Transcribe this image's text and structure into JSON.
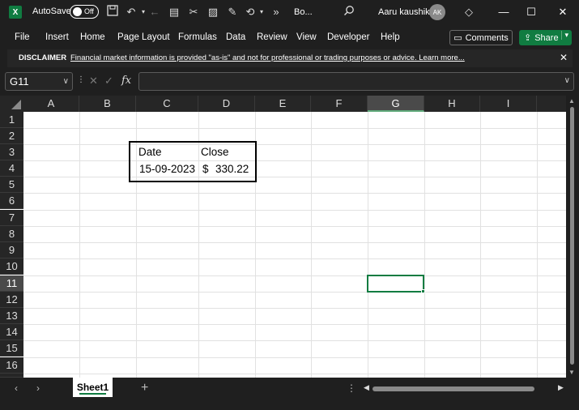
{
  "titlebar": {
    "app_icon": "X",
    "autosave_label": "AutoSave",
    "autosave_state": "Off",
    "doc_title": "Bo...",
    "user_name": "Aaru kaushik",
    "user_initials": "AK",
    "more": "»"
  },
  "menu": {
    "items": [
      "File",
      "Insert",
      "Home",
      "Page Layout",
      "Formulas",
      "Data",
      "Review",
      "View",
      "Developer",
      "Help"
    ],
    "comments_label": "Comments",
    "share_label": "Share"
  },
  "disclaimer": {
    "label": "DISCLAIMER",
    "message": "Financial market information is provided \"as-is\" and not for professional or trading purposes or advice. Learn more..."
  },
  "formula_bar": {
    "name_box": "G11",
    "fx": "fx",
    "formula": ""
  },
  "grid": {
    "columns": [
      "A",
      "B",
      "C",
      "D",
      "E",
      "F",
      "G",
      "H",
      "I"
    ],
    "rows": [
      "1",
      "2",
      "3",
      "4",
      "5",
      "6",
      "7",
      "8",
      "9",
      "10",
      "11",
      "12",
      "13",
      "14",
      "15",
      "16"
    ],
    "selected_column": "G",
    "selected_row": "11",
    "cells": {
      "C3": "Date",
      "D3": "Close",
      "C4": "15-09-2023",
      "D4_currency": "$",
      "D4_value": "330.22"
    }
  },
  "sheets": {
    "tabs": [
      "Sheet1"
    ],
    "active": "Sheet1",
    "add_label": "+"
  },
  "colors": {
    "accent_green": "#107c41",
    "chrome_dark": "#1f1f1f"
  }
}
